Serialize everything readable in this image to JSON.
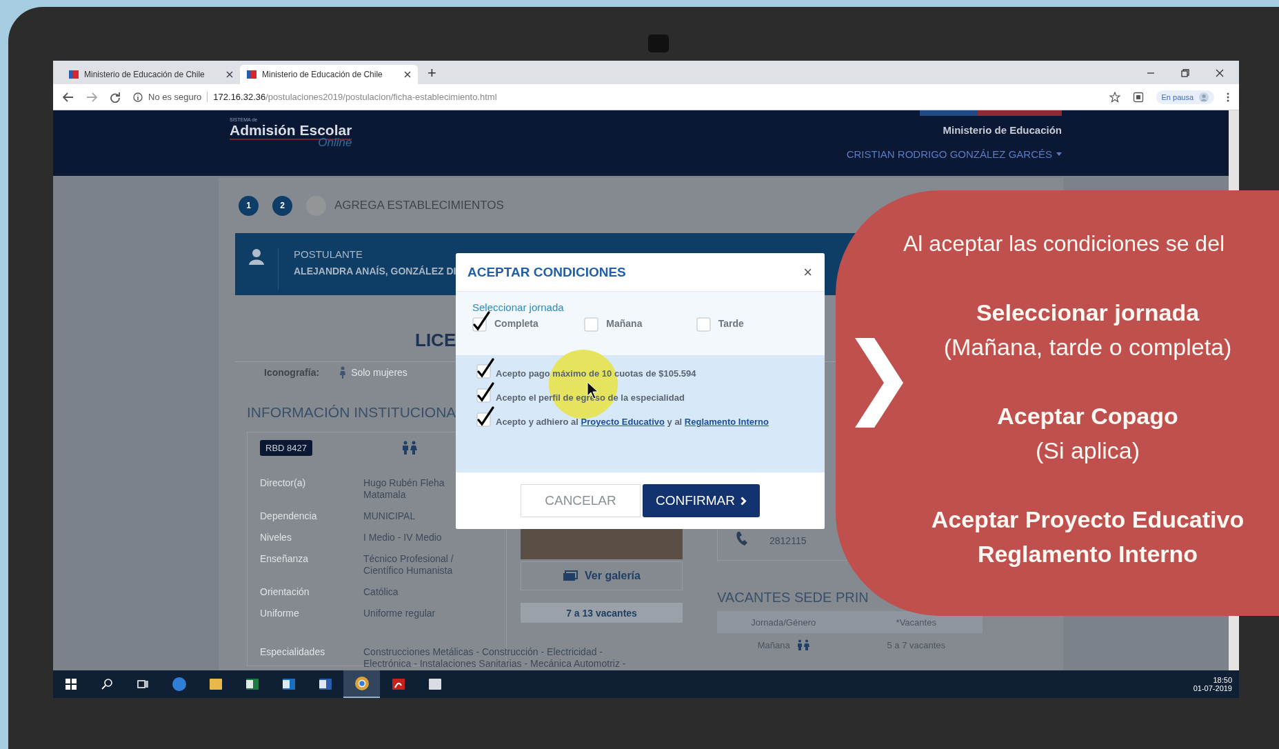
{
  "browser": {
    "tabs": [
      {
        "title": "Ministerio de Educación de Chile",
        "selected": false
      },
      {
        "title": "Ministerio de Educación de Chile",
        "selected": true
      }
    ],
    "new_tab": "+",
    "security_label": "No es seguro",
    "url_host": "172.16.32.36",
    "url_path": "/postulaciones2019/postulacion/ficha-establecimiento.html",
    "profile_status": "En pausa"
  },
  "site_header": {
    "logo_prefix": "SISTEMA de",
    "logo": "Admisión Escolar",
    "logo_script": "Online",
    "ministry": "Ministerio de Educación",
    "user_name": "CRISTIAN RODRIGO GONZÁLEZ GARCÉS"
  },
  "steps": [
    {
      "label": "1",
      "done": true
    },
    {
      "label": "2",
      "done": true
    },
    {
      "done": false
    }
  ],
  "step_title": "AGREGA ESTABLECIMIENTOS",
  "applicant": {
    "label": "POSTULANTE",
    "name": "ALEJANDRA ANAÍS, GONZÁLEZ DI"
  },
  "school": {
    "title": "LICE",
    "legend_label": "Iconografía:",
    "legend_item": "Solo mujeres",
    "section_title": "INFORMACIÓN INSTITUCIONA",
    "rbd": "RBD 8427",
    "details": [
      {
        "label": "Director(a)",
        "lines": [
          "Hugo Rubén Fleha",
          "Matamala"
        ]
      },
      {
        "label": "Dependencia",
        "lines": [
          "MUNICIPAL"
        ]
      },
      {
        "label": "Niveles",
        "lines": [
          "I Medio - IV Medio"
        ]
      },
      {
        "label": "Enseñanza",
        "lines": [
          "Técnico Profesional /",
          "Científico Humanista"
        ]
      },
      {
        "label": "Orientación",
        "lines": [
          "Católica"
        ]
      },
      {
        "label": "Uniforme",
        "lines": [
          "Uniforme regular"
        ]
      },
      {
        "label": "Especialidades",
        "lines": [
          "Construcciones Metálicas - Construcción - Electricidad -",
          "Electrónica - Instalaciones Sanitarias - Mecánica Automotriz -"
        ]
      }
    ],
    "gallery_button": "Ver galería",
    "vacancies_badge": "7 a 13 vacantes",
    "phone": "2812115",
    "vacancies_title": "VACANTES SEDE PRIN",
    "vacancies_table": {
      "columns": [
        "Jornada/Género",
        "*Vacantes"
      ],
      "rows": [
        [
          "Mañana",
          "5 a 7 vacantes"
        ]
      ]
    }
  },
  "modal": {
    "title": "ACEPTAR CONDICIONES",
    "close": "×",
    "shift_label": "Seleccionar jornada",
    "shifts": [
      {
        "label": "Completa",
        "checked": true
      },
      {
        "label": "Mañana",
        "checked": false
      },
      {
        "label": "Tarde",
        "checked": false
      }
    ],
    "agreements": [
      {
        "checked": true,
        "segments": [
          {
            "text": "Acepto pago máximo de 10 cuotas de $105.594",
            "link": false
          }
        ]
      },
      {
        "checked": true,
        "segments": [
          {
            "text": "Acepto el perfil de egreso de la especialidad",
            "link": false
          }
        ]
      },
      {
        "checked": true,
        "segments": [
          {
            "text": "Acepto y adhiero al ",
            "link": false
          },
          {
            "text": "Proyecto Educativo",
            "link": true
          },
          {
            "text": " y al ",
            "link": false
          },
          {
            "text": "Reglamento Interno",
            "link": true
          }
        ]
      }
    ],
    "cancel": "CANCELAR",
    "confirm": "CONFIRMAR"
  },
  "callout": {
    "intro": "Al aceptar las condiciones se del",
    "items": [
      {
        "title_lines": [
          "Seleccionar jornada"
        ],
        "note": "(Mañana, tarde o completa)"
      },
      {
        "title_lines": [
          "Aceptar Copago"
        ],
        "note": "(Si aplica)"
      },
      {
        "title_lines": [
          "Aceptar Proyecto Educativo",
          "Reglamento Interno"
        ]
      }
    ]
  },
  "taskbar": {
    "apps": [
      {
        "kind": "edge",
        "selected": false
      },
      {
        "kind": "folder",
        "selected": false
      },
      {
        "kind": "sheet",
        "selected": false
      },
      {
        "kind": "mail",
        "selected": false
      },
      {
        "kind": "doc",
        "selected": false
      },
      {
        "kind": "browser",
        "selected": true
      },
      {
        "kind": "pdf",
        "selected": false
      },
      {
        "kind": "photo",
        "selected": false
      }
    ],
    "time": "18:50",
    "date": "01-07-2019"
  }
}
